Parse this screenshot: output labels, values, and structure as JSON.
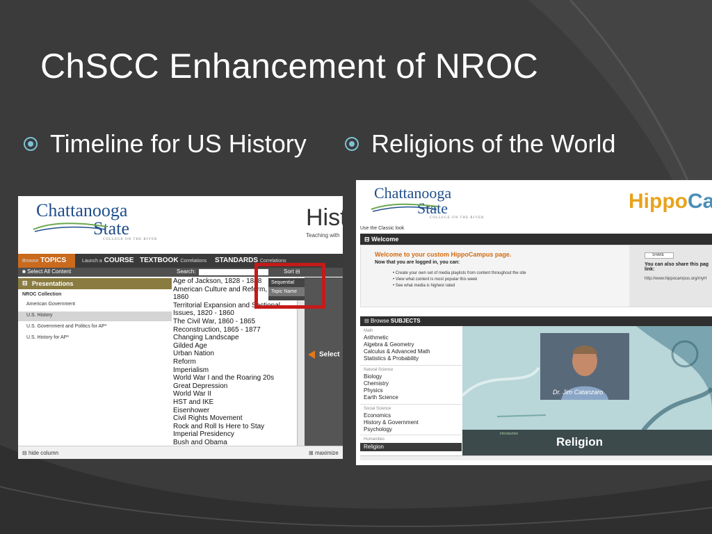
{
  "slide": {
    "title": "ChSCC Enhancement of NROC",
    "bullets": [
      "Timeline for US History",
      "Religions of the World"
    ]
  },
  "left_screenshot": {
    "logo_line1": "Chattanooga",
    "logo_line2": "State",
    "logo_tagline": "COLLEGE ON THE RIVER",
    "header_title": "Hist",
    "header_subtitle": "Teaching with",
    "nav": {
      "browse": "Browse",
      "topics": "TOPICS",
      "launch": "Launch a",
      "course": "COURSE",
      "textbook": "TEXTBOOK",
      "textbook_small": "Correlations",
      "standards": "STANDARDS",
      "standards_small": "Correlations"
    },
    "select_all": "Select All Content",
    "search_label": "Search:",
    "sort_label": "Sort",
    "sort_options": [
      "Sequential",
      "Topic Name"
    ],
    "presentations_header": "Presentations",
    "collection_label": "NROC Collection",
    "collection_items": [
      "American Government",
      "U.S. History",
      "U.S. Government and Politics for AP*",
      "U.S. History for AP*"
    ],
    "topics": [
      "Age of Jackson, 1828 - 1848",
      "American Culture and Reform,",
      "1860",
      "Territorial Expansion and Sectional",
      "Issues, 1820 - 1860",
      "The Civil War, 1860 - 1865",
      "Reconstruction, 1865 - 1877",
      "Changing Landscape",
      "Gilded Age",
      "Urban Nation",
      "Reform",
      "Imperialism",
      "World War I and the Roaring 20s",
      "Great Depression",
      "World War II",
      "HST and IKE",
      "Eisenhower",
      "Civil Rights Movement",
      "Rock and Roll Is Here to Stay",
      "Imperial Presidency",
      "Bush and Obama"
    ],
    "select_button": "Select",
    "hide_column": "hide column",
    "maximize": "maximize"
  },
  "right_screenshot": {
    "logo_line1": "Chattanooga",
    "logo_line2": "State",
    "logo_tagline": "COLLEGE ON THE RIVER",
    "hippo_part1": "Hippo",
    "hippo_part2": "Ca",
    "classic_link": "Use the Classic look",
    "welcome_header": "Welcome",
    "welcome_title": "Welcome to your custom HippoCampus page.",
    "welcome_sub": "Now that you are logged in, you can:",
    "welcome_items": [
      "Create your own set of media playlists from content throughout the site",
      "View what content is most popular this week",
      "See what media is highest rated"
    ],
    "share_button": "SHARE",
    "share_text": "You can also share this pag",
    "share_text2": "link:",
    "share_url": "http://www.hippocampus.org/myH",
    "browse_label": "Browse",
    "subjects_label": "SUBJECTS",
    "subject_groups": [
      {
        "category": "Math",
        "items": [
          "Arithmetic",
          "Algebra & Geometry",
          "Calculus & Advanced Math",
          "Statistics & Probability"
        ]
      },
      {
        "category": "Natural Science",
        "items": [
          "Biology",
          "Chemistry",
          "Physics",
          "Earth Science"
        ]
      },
      {
        "category": "Social Science",
        "items": [
          "Economics",
          "History & Government",
          "Psychology"
        ]
      },
      {
        "category": "Humanities",
        "items": [
          "Religion"
        ]
      }
    ],
    "video_caption": "Dr. Jim Catanzaro",
    "intro_label": "Introduction",
    "media_title": "Religion"
  }
}
